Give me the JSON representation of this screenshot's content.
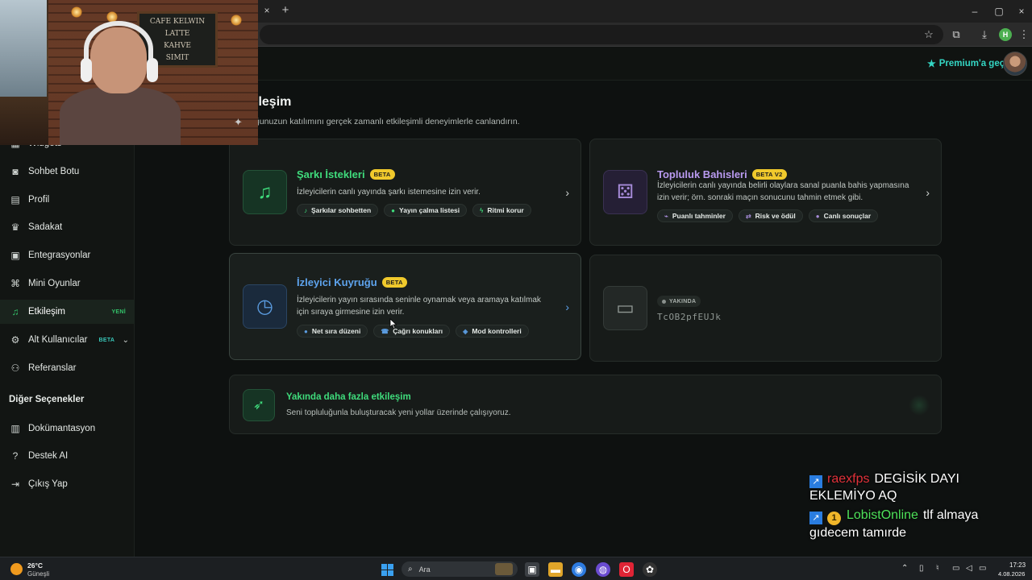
{
  "browser": {
    "tab_close_glyph": "×",
    "new_tab_glyph": "+",
    "window_controls": [
      "–",
      "▢",
      "×"
    ]
  },
  "header": {
    "premium_label": "Premium'a geç"
  },
  "webcam": {
    "board_lines": [
      "CAFE KELWIN",
      "LATTE",
      "KAHVE",
      "SIMIT",
      "CAFE KELWIN"
    ]
  },
  "sidebar": {
    "items": [
      {
        "label": "Widgets",
        "icon": "widgets-icon"
      },
      {
        "label": "Sohbet Botu",
        "icon": "robot-icon"
      },
      {
        "label": "Profil",
        "icon": "id-card-icon"
      },
      {
        "label": "Sadakat",
        "icon": "trophy-icon"
      },
      {
        "label": "Entegrasyonlar",
        "icon": "plug-icon"
      },
      {
        "label": "Mini Oyunlar",
        "icon": "gamepad-icon"
      },
      {
        "label": "Etkileşim",
        "icon": "music-icon",
        "badge": "YENİ",
        "active": true
      },
      {
        "label": "Alt Kullanıcılar",
        "icon": "users-icon",
        "badge": "BETA"
      },
      {
        "label": "Referanslar",
        "icon": "user-group-icon"
      }
    ],
    "section_title": "Diğer Seçenekler",
    "other_items": [
      {
        "label": "Dokümantasyon",
        "icon": "book-icon"
      },
      {
        "label": "Destek AI",
        "icon": "help-icon"
      },
      {
        "label": "Çıkış Yap",
        "icon": "logout-icon"
      }
    ]
  },
  "main": {
    "title": "ileşim",
    "subtitle": "ğunuzun katılımını gerçek zamanlı etkileşimli deneyimlerle canlandırın.",
    "cards": [
      {
        "title": "Şarkı İstekleri",
        "badge": "BETA",
        "description": "İzleyicilerin canlı yayında şarkı istemesine izin verir.",
        "icon": "music-note-icon",
        "chips": [
          "Şarkılar sohbetten",
          "Yayın çalma listesi",
          "Ritmi korur"
        ]
      },
      {
        "title": "Topluluk Bahisleri",
        "badge": "BETA V2",
        "description": "İzleyicilerin canlı yayında belirli olaylara sanal puanla bahis yapmasına izin verir; örn. sonraki maçın sonucunu tahmin etmek gibi.",
        "icon": "dice-icon",
        "chips": [
          "Puanlı tahminler",
          "Risk ve ödül",
          "Canlı sonuçlar"
        ]
      },
      {
        "title": "İzleyici Kuyruğu",
        "badge": "BETA",
        "description": "İzleyicilerin yayın sırasında seninle oynamak veya aramaya katılmak için sıraya girmesine izin verir.",
        "icon": "clock-icon",
        "chips": [
          "Net sıra düzeni",
          "Çağrı konukları",
          "Mod kontrolleri"
        ]
      }
    ],
    "soon_card": {
      "badge": "YAKINDA",
      "code": "TcOB2pfEUJk",
      "icon": "ticket-icon"
    },
    "more": {
      "title": "Yakında daha fazla etkileşim",
      "description": "Seni topluluğunla buluşturacak yeni yollar üzerinde çalışıyoruz."
    }
  },
  "chat_overlay": [
    {
      "user": "raexfps",
      "message": "DEGİSİK DAYI EKLEMİYO AQ",
      "user_color": "#e2313a"
    },
    {
      "user": "LobistOnline",
      "badge": "1",
      "message": "tlf almaya gıdecem tamırde",
      "user_color": "#4ee25a"
    }
  ],
  "taskbar": {
    "weather_temp": "26°C",
    "weather_desc": "Güneşli",
    "search_placeholder": "Ara",
    "time": "17:23",
    "date": "4.08.2026"
  },
  "colors": {
    "accent_green": "#3fdc7c",
    "accent_purple": "#b99af0",
    "accent_blue": "#5ea4ee",
    "premium_teal": "#34d6c4",
    "beta_yellow": "#f0c92c"
  }
}
